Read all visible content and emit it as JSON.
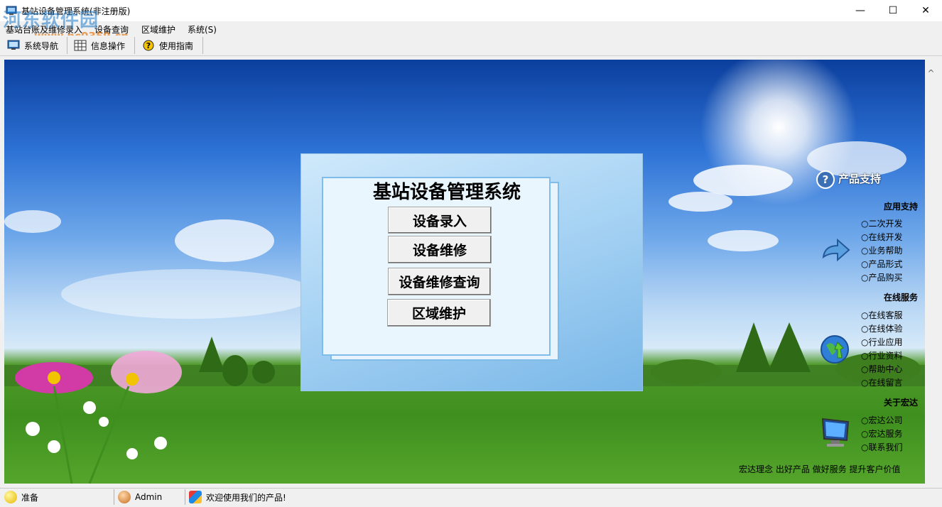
{
  "window": {
    "title": "基站设备管理系统(非注册版)",
    "minimize_symbol": "—",
    "maximize_symbol": "☐",
    "close_symbol": "✕"
  },
  "watermark": {
    "line1": "河东软件园",
    "line2": "www.pc0359.cn"
  },
  "menu": [
    "基站台账及维修录入",
    "设备查询",
    "区域维护",
    "系统(S)"
  ],
  "toolbar": [
    {
      "label": "系统导航",
      "icon": "monitor-icon"
    },
    {
      "label": "信息操作",
      "icon": "grid-icon"
    },
    {
      "label": "使用指南",
      "icon": "help-icon"
    }
  ],
  "panel": {
    "title": "基站设备管理系统",
    "buttons": [
      "设备录入",
      "设备维修",
      "设备维修查询",
      "区域维护"
    ]
  },
  "side": {
    "support_icon": "?",
    "support_title": "产品支持",
    "sections": [
      {
        "title": "应用支持",
        "links": [
          "二次开发",
          "在线开发",
          "业务帮助",
          "产品形式",
          "产品购买"
        ]
      },
      {
        "title": "在线服务",
        "links": [
          "在线客服",
          "在线体验",
          "行业应用",
          "行业资料",
          "帮助中心",
          "在线留言"
        ]
      },
      {
        "title": "关于宏达",
        "links": [
          "宏达公司",
          "宏达服务",
          "联系我们"
        ]
      }
    ],
    "link_bullet": "○",
    "slogan": "宏达理念 出好产品 做好服务 提升客户价值"
  },
  "status": {
    "state": "准备",
    "user": "Admin",
    "message": "欢迎使用我们的产品!"
  },
  "colors": {
    "sky": "#2e73d6",
    "grass": "#4f9a2a",
    "panel": "#a9d4f4",
    "accent": "#1e78c8"
  }
}
